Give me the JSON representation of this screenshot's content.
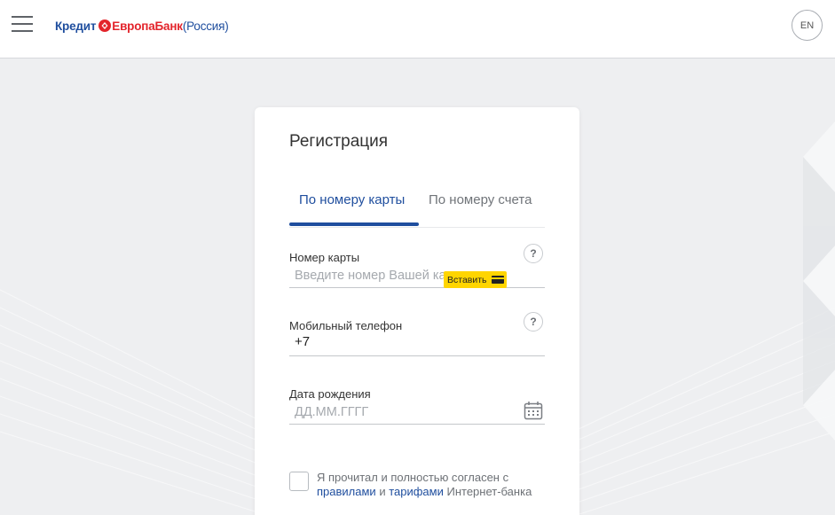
{
  "header": {
    "logo": {
      "part1": "Кредит",
      "part2": "ЕвропаБанк",
      "part3": "(Россия)"
    },
    "lang_label": "EN"
  },
  "registration": {
    "title": "Регистрация",
    "tabs": [
      {
        "label": "По номеру карты",
        "active": true
      },
      {
        "label": "По номеру счета",
        "active": false
      }
    ],
    "card_number": {
      "label": "Номер карты",
      "placeholder": "Введите номер Вашей карты",
      "value": "",
      "paste_label": "Вставить",
      "help": "?"
    },
    "phone": {
      "label": "Мобильный телефон",
      "prefix": "+7",
      "value": "",
      "help": "?"
    },
    "birth_date": {
      "label": "Дата рождения",
      "placeholder": "ДД.ММ.ГГГГ",
      "value": ""
    },
    "agreement": {
      "text_before": "Я прочитал и полностью согласен с",
      "link_rules": "правилами",
      "text_and": "и",
      "link_tariffs": "тарифами",
      "text_after": "Интернет-банка",
      "checked": false
    }
  },
  "colors": {
    "brand_blue": "#1f4e9e",
    "brand_red": "#e3242b",
    "paste_yellow": "#ffd500",
    "background": "#eeeff1"
  },
  "icons": [
    "menu-icon",
    "logo-icon",
    "help-icon",
    "card-icon",
    "calendar-icon"
  ]
}
